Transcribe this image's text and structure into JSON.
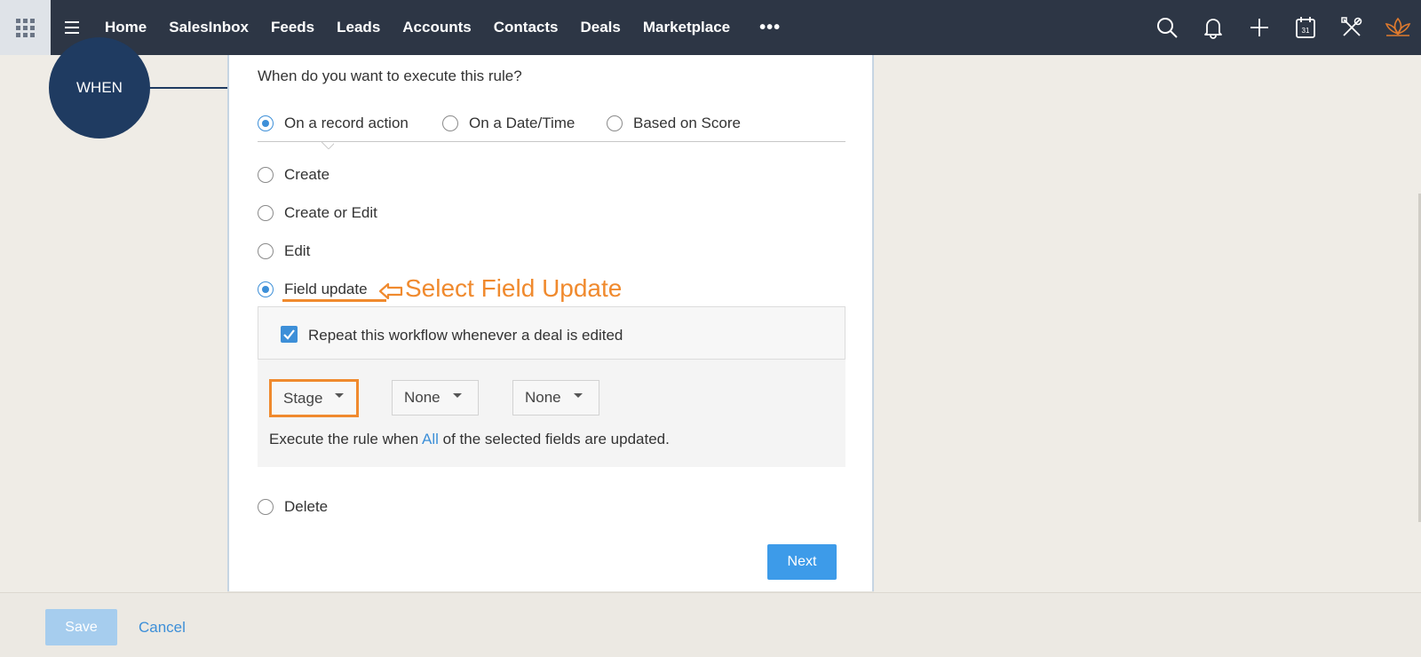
{
  "nav": {
    "items": [
      "Home",
      "SalesInbox",
      "Feeds",
      "Leads",
      "Accounts",
      "Contacts",
      "Deals",
      "Marketplace"
    ],
    "more": "•••",
    "icons": [
      "search-icon",
      "bell-icon",
      "plus-icon",
      "calendar-icon",
      "tools-icon",
      "lotus-icon"
    ],
    "calendar_day": "31"
  },
  "flow": {
    "when_label": "WHEN"
  },
  "rule": {
    "question": "When do you want to execute this rule?",
    "trigger_types": [
      {
        "label": "On a record action",
        "checked": true
      },
      {
        "label": "On a Date/Time",
        "checked": false
      },
      {
        "label": "Based on Score",
        "checked": false
      }
    ],
    "actions": [
      {
        "label": "Create",
        "checked": false
      },
      {
        "label": "Create or Edit",
        "checked": false
      },
      {
        "label": "Edit",
        "checked": false
      },
      {
        "label": "Field update",
        "checked": true
      },
      {
        "label": "Delete",
        "checked": false
      }
    ],
    "annotation": "Select Field Update",
    "repeat_label": "Repeat this workflow whenever a deal is edited",
    "repeat_checked": true,
    "fields": [
      "Stage",
      "None",
      "None"
    ],
    "execute_prefix": "Execute the rule when",
    "execute_mode": "All",
    "execute_suffix": "of the selected fields are updated.",
    "next_label": "Next"
  },
  "footer": {
    "save_label": "Save",
    "cancel_label": "Cancel"
  },
  "colors": {
    "nav_bg": "#2d3645",
    "accent": "#3d8fd8",
    "annotation": "#f08a2e",
    "when_node": "#1f3b61"
  }
}
